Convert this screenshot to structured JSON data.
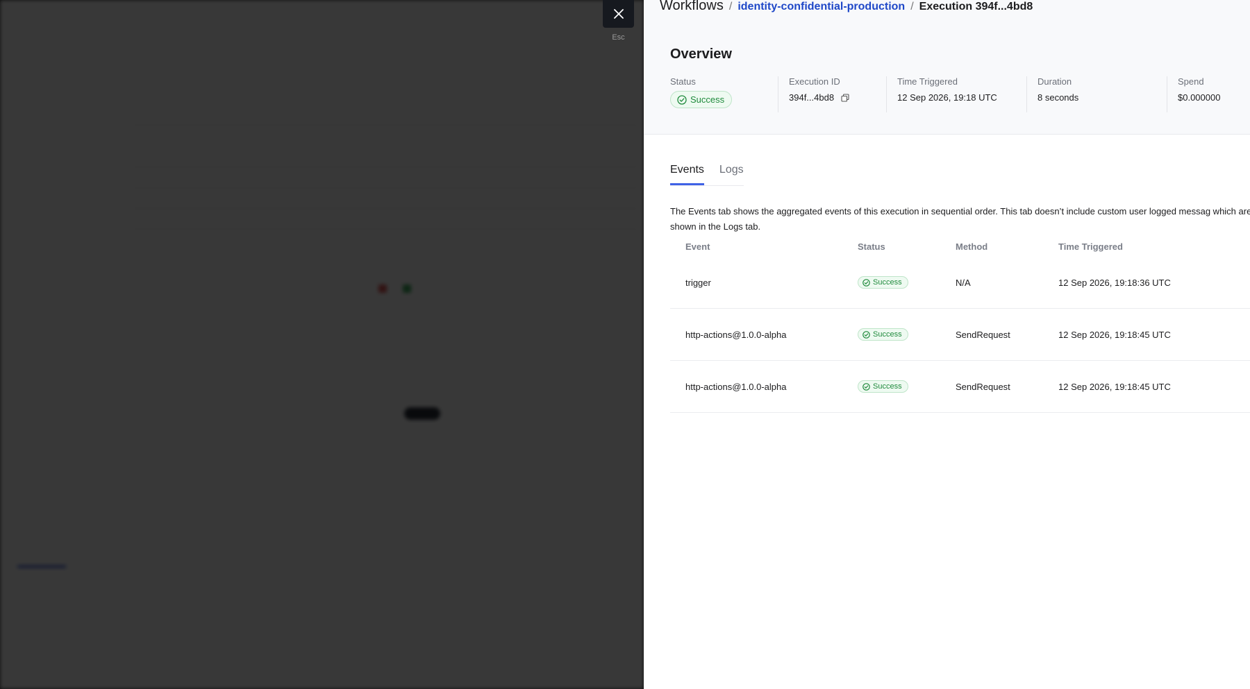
{
  "colors": {
    "accent": "#1f48c8",
    "tab_indicator": "#3f62e6",
    "success_text": "#1f8a3c",
    "success_bg": "#eefaf1",
    "success_border": "#bfe5c9",
    "backdrop": "#000000"
  },
  "close": {
    "icon": "close-icon",
    "hint": "Esc"
  },
  "breadcrumb": {
    "root": "Workflows",
    "separator": "/",
    "workflow": "identity-confidential-production",
    "current": "Execution 394f...4bd8"
  },
  "overview": {
    "title": "Overview",
    "status_label": "Status",
    "status_value": "Success",
    "execution_id_label": "Execution ID",
    "execution_id_value": "394f...4bd8",
    "time_label": "Time Triggered",
    "time_value": "12 Sep 2026, 19:18 UTC",
    "duration_label": "Duration",
    "duration_value": "8 seconds",
    "spend_label": "Spend",
    "spend_value": "$0.000000"
  },
  "tabs": [
    {
      "label": "Events",
      "active": true
    },
    {
      "label": "Logs",
      "active": false
    }
  ],
  "description": "The Events tab shows the aggregated events of this execution in sequential order. This tab doesn’t include custom user logged messag which are shown in the Logs tab.",
  "events_table": {
    "columns": [
      "Event",
      "Status",
      "Method",
      "Time Triggered"
    ],
    "rows": [
      {
        "event": "trigger",
        "status": "Success",
        "method": "N/A",
        "time": "12 Sep 2026, 19:18:36 UTC"
      },
      {
        "event": "http-actions@1.0.0-alpha",
        "status": "Success",
        "method": "SendRequest",
        "time": "12 Sep 2026, 19:18:45 UTC"
      },
      {
        "event": "http-actions@1.0.0-alpha",
        "status": "Success",
        "method": "SendRequest",
        "time": "12 Sep 2026, 19:18:45 UTC"
      }
    ]
  }
}
